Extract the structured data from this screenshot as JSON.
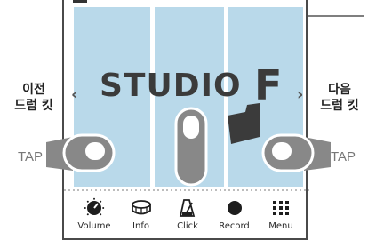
{
  "screen": {
    "kit_name": "STUDIO",
    "kit_letter": "F"
  },
  "nav": {
    "prev_label_line1": "이전",
    "prev_label_line2": "드럼 킷",
    "next_label_line1": "다음",
    "next_label_line2": "드럼 킷",
    "prev_chevron": "‹",
    "next_chevron": "›"
  },
  "gestures": {
    "tap_left": "TAP",
    "tap_right": "TAP"
  },
  "tabbar": {
    "items": [
      {
        "label": "Volume",
        "icon": "volume-knob-icon"
      },
      {
        "label": "Info",
        "icon": "drum-icon"
      },
      {
        "label": "Click",
        "icon": "metronome-icon"
      },
      {
        "label": "Record",
        "icon": "record-dot-icon"
      },
      {
        "label": "Menu",
        "icon": "grid-menu-icon"
      }
    ]
  },
  "colors": {
    "zone": "#b9d9ea",
    "ink": "#3b3b3b",
    "finger": "#888888"
  }
}
